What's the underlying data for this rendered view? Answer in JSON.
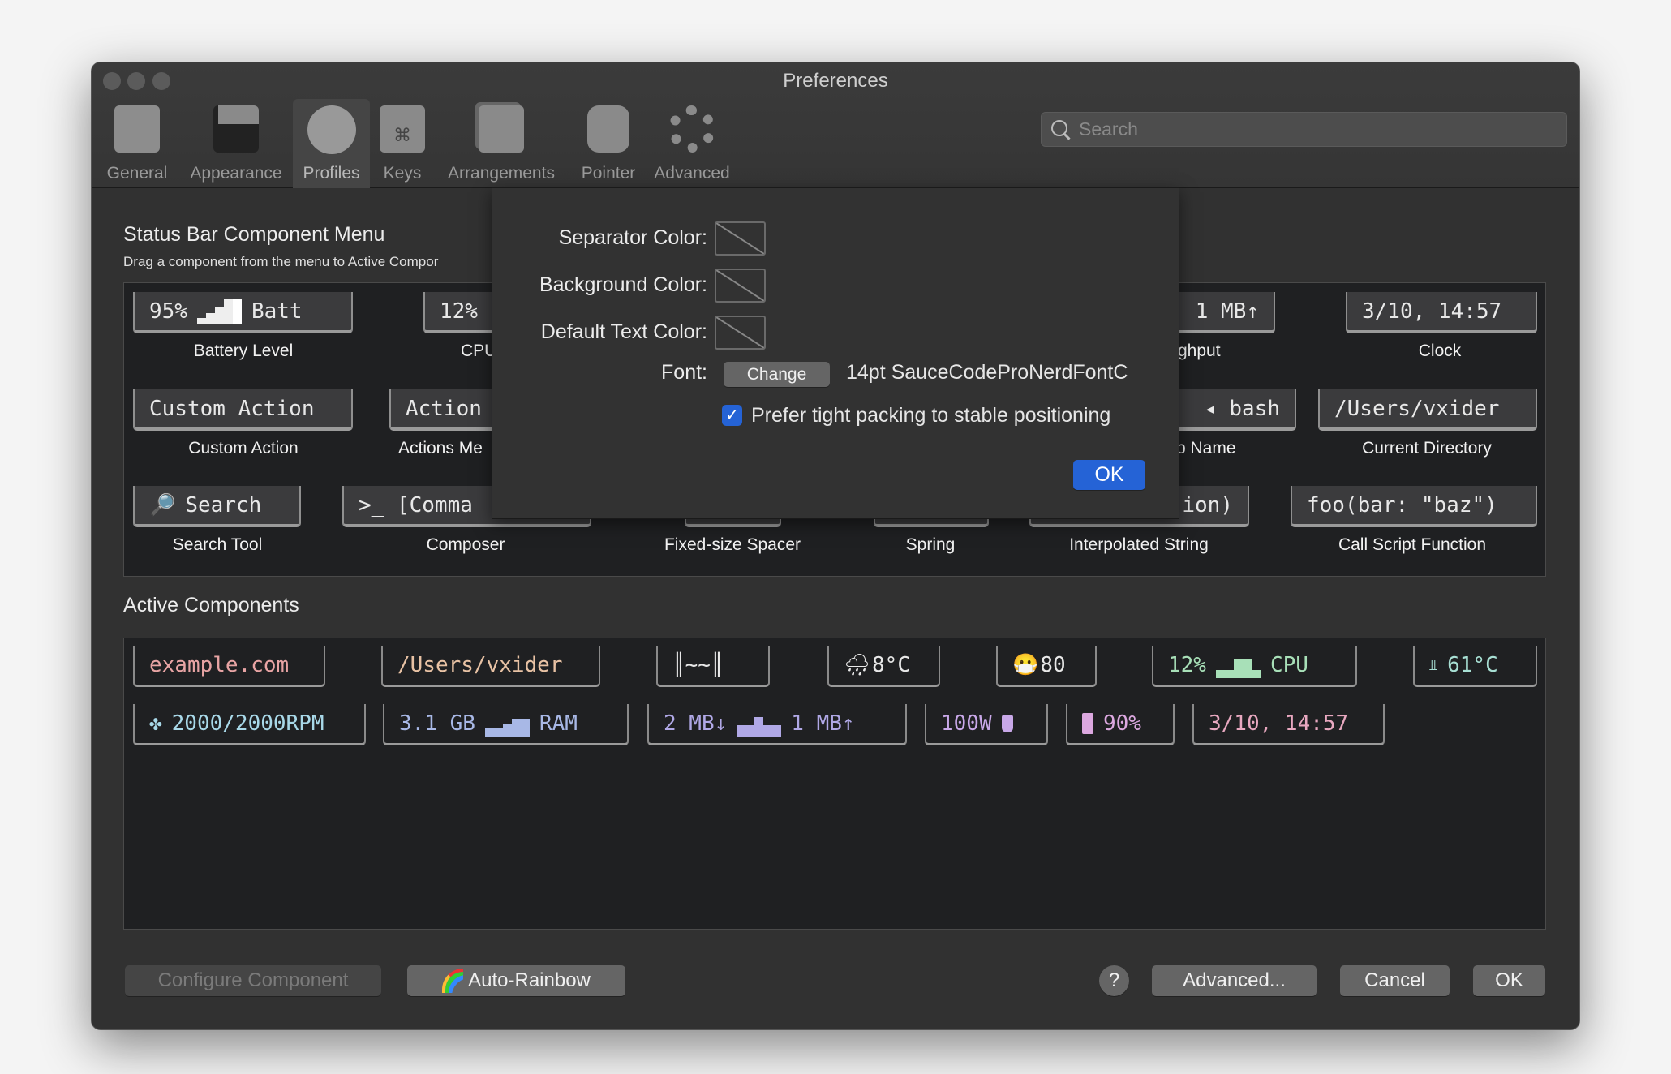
{
  "window": {
    "title": "Preferences"
  },
  "toolbar": {
    "items": [
      {
        "label": "General",
        "icon": "general-switch-icon"
      },
      {
        "label": "Appearance",
        "icon": "appearance-window-icon"
      },
      {
        "label": "Profiles",
        "icon": "profile-person-icon",
        "selected": true
      },
      {
        "label": "Keys",
        "icon": "command-key-icon"
      },
      {
        "label": "Arrangements",
        "icon": "arrangements-windows-icon"
      },
      {
        "label": "Pointer",
        "icon": "mouse-icon"
      },
      {
        "label": "Advanced",
        "icon": "gear-icon"
      }
    ],
    "search_placeholder": "Search"
  },
  "menu": {
    "title": "Status Bar Component Menu",
    "subtitle": "Drag a component from the menu to Active Compor",
    "components": [
      {
        "text_a": "95%",
        "text_b": "Batt",
        "label": "Battery Level"
      },
      {
        "text_a": "12%",
        "label": "CPU"
      },
      {
        "text_a": "1 MB↑",
        "label": "ghput"
      },
      {
        "text_a": "3/10, 14:57",
        "label": "Clock"
      },
      {
        "text_a": "Custom Action",
        "label": "Custom Action"
      },
      {
        "text_a": "Action",
        "label": "Actions Me"
      },
      {
        "text_a": "◂ bash",
        "label": "b Name"
      },
      {
        "text_a": "/Users/vxider",
        "label": "Current Directory"
      },
      {
        "text_a": "Search",
        "label": "Search Tool"
      },
      {
        "text_a": ">_ [Comma",
        "label": "Composer"
      },
      {
        "text_a": "",
        "label": "Fixed-size Spacer"
      },
      {
        "text_a": "",
        "label": "Spring"
      },
      {
        "text_a": "ion)",
        "label": "Interpolated String"
      },
      {
        "text_a": "foo(bar: \"baz\")",
        "label": "Call Script Function"
      }
    ]
  },
  "popover": {
    "separator_label": "Separator Color:",
    "background_label": "Background Color:",
    "text_color_label": "Default Text Color:",
    "font_label": "Font:",
    "change_button": "Change",
    "font_value": "14pt SauceCodeProNerdFontC",
    "checkbox_label": "Prefer tight packing to stable positioning",
    "checkbox_checked": true,
    "ok": "OK"
  },
  "active": {
    "title": "Active Components",
    "row1": [
      {
        "text": "example.com",
        "color": "#e8a4a4"
      },
      {
        "text": "/Users/vxider",
        "color": "#e8c2a4"
      },
      {
        "text": "║~~║",
        "color": "#e8e8e8"
      },
      {
        "text": "8°C",
        "icon": "rain-cloud-icon",
        "color": "#e8e8e8"
      },
      {
        "text": "80",
        "icon": "mask-face-icon",
        "color": "#e8e8e8"
      },
      {
        "text": "12%",
        "text_b": "CPU",
        "color": "#a8e0b8"
      },
      {
        "text": "61°C",
        "icon": "thermometer-icon",
        "color": "#a8e0d4"
      }
    ],
    "row2": [
      {
        "text": "2000/2000RPM",
        "icon": "fan-icon",
        "color": "#a8d8e8"
      },
      {
        "text": "3.1 GB",
        "text_b": "RAM",
        "color": "#a8b8e6"
      },
      {
        "text": "2 MB↓",
        "text_b": "1 MB↑",
        "color": "#b0a8e6"
      },
      {
        "text": "100W",
        "icon": "plug-icon",
        "color": "#c8a8e8"
      },
      {
        "text": "90%",
        "icon": "battery-icon",
        "color": "#dca8e0"
      },
      {
        "text": "3/10, 14:57",
        "color": "#e8a8c0"
      }
    ]
  },
  "footer": {
    "configure": "Configure Component",
    "rainbow": "Auto-Rainbow",
    "help": "?",
    "advanced": "Advanced...",
    "cancel": "Cancel",
    "ok": "OK"
  }
}
